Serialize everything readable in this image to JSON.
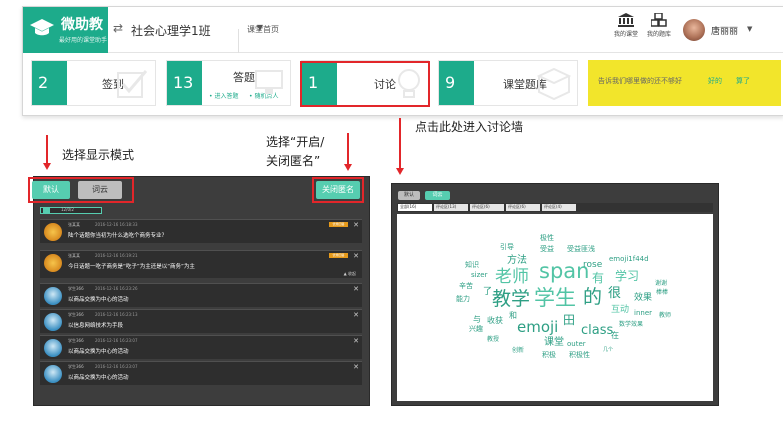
{
  "app": {
    "logo_title": "微助教",
    "logo_sub": "最好用的课堂助手",
    "class_name": "社会心理学1班",
    "breadcrumb": "课堂首页",
    "icons": [
      {
        "icon": "bank-icon",
        "label": "我的课堂"
      },
      {
        "icon": "cubes-icon",
        "label": "我的题库"
      }
    ],
    "user_name": "唐丽丽",
    "brand_color": "#1dab8b"
  },
  "cards": [
    {
      "num": "2",
      "label": "签到",
      "icon": "checkbox-icon"
    },
    {
      "num": "13",
      "label": "答题",
      "sub1": "• 进入答题",
      "sub2": "• 随机点人",
      "icon": "monitor-icon"
    },
    {
      "num": "1",
      "label": "讨论",
      "icon": "bulb-icon"
    },
    {
      "num": "9",
      "label": "课堂题库",
      "icon": "box-icon"
    }
  ],
  "feedback": {
    "question": "告诉我们哪里做的还不够好",
    "link1": "好的",
    "link2": "算了"
  },
  "annotations": {
    "enter": "点击此处进入讨论墙",
    "mode": "选择显示模式",
    "anon_line1": "选择“开启/",
    "anon_line2": "关闭匿名”"
  },
  "left": {
    "mode_default": "默认",
    "mode_cloud": "词云",
    "anon_button": "关闭匿名",
    "filter_label": "12/0/2",
    "collapse": "▲ 收起",
    "messages": [
      {
        "name": "张某某",
        "time": "2016-12-16 16:18:33",
        "text": "陆个话题你当初为什么选吃个商务专业？",
        "tag": "优秀回答",
        "av": "lion"
      },
      {
        "name": "张某某",
        "time": "2016-12-16 16:19:21",
        "text": "今日话题一吃子商务是“吃子”为主还是以“商务”为主",
        "tag": "优秀回答",
        "av": "lion"
      },
      {
        "name": "学生366",
        "time": "2016-12-16 16:23:26",
        "text": "以商品交换为中心的活动",
        "av": "student"
      },
      {
        "name": "学生366",
        "time": "2016-12-16 16:23:13",
        "text": "以信息网络技术为手段",
        "av": "student"
      },
      {
        "name": "学生366",
        "time": "2016-12-16 16:23:07",
        "text": "以商品交换为中心的活动",
        "av": "student"
      },
      {
        "name": "学生366",
        "time": "2016-12-16 16:23:07",
        "text": "以商品交换为中心的活动",
        "av": "student"
      }
    ]
  },
  "right": {
    "mode_default": "默认",
    "mode_cloud": "词云",
    "tabs": [
      "全部(16)",
      "评论区(13)",
      "评论区(6)",
      "评论区(6)",
      "评论区(4)"
    ],
    "words": [
      {
        "t": "span",
        "c": "#52c4a5",
        "s": 21
      },
      {
        "t": "学生",
        "c": "#52c4a5",
        "s": 21
      },
      {
        "t": "教学",
        "c": "#2e9f84",
        "s": 19
      },
      {
        "t": "的",
        "c": "#2e9f84",
        "s": 19
      },
      {
        "t": "老师",
        "c": "#52c4a5",
        "s": 17
      },
      {
        "t": "emoji",
        "c": "#2e9f84",
        "s": 15
      },
      {
        "t": "class",
        "c": "#2e9f84",
        "s": 13
      },
      {
        "t": "学习",
        "c": "#52c4a5",
        "s": 12
      },
      {
        "t": "很",
        "c": "#2e9f84",
        "s": 13
      },
      {
        "t": "有",
        "c": "#52c4a5",
        "s": 12
      },
      {
        "t": "方法",
        "c": "#2e9f84",
        "s": 10
      },
      {
        "t": "rose",
        "c": "#2e9f84",
        "s": 9
      },
      {
        "t": "田",
        "c": "#2e9f84",
        "s": 12
      },
      {
        "t": "课堂",
        "c": "#2e9f84",
        "s": 10
      },
      {
        "t": "效果",
        "c": "#2e9f84",
        "s": 9
      },
      {
        "t": "互动",
        "c": "#52c4a5",
        "s": 9
      },
      {
        "t": "emoji1f44d",
        "c": "#2e9f84",
        "s": 7
      },
      {
        "t": "收获",
        "c": "#2e9f84",
        "s": 8
      },
      {
        "t": "积极",
        "c": "#2e9f84",
        "s": 7
      },
      {
        "t": "积极性",
        "c": "#2e9f84",
        "s": 7
      },
      {
        "t": "outer",
        "c": "#2e9f84",
        "s": 7
      },
      {
        "t": "inner",
        "c": "#2e9f84",
        "s": 7
      },
      {
        "t": "教师",
        "c": "#2e9f84",
        "s": 6
      },
      {
        "t": "谢谢",
        "c": "#2e9f84",
        "s": 6
      },
      {
        "t": "棒棒",
        "c": "#2e9f84",
        "s": 6
      },
      {
        "t": "数学效果",
        "c": "#2e9f84",
        "s": 6
      },
      {
        "t": "引导",
        "c": "#2e9f84",
        "s": 7
      },
      {
        "t": "知识",
        "c": "#2e9f84",
        "s": 7
      },
      {
        "t": "sizer",
        "c": "#2e9f84",
        "s": 7
      },
      {
        "t": "辛苦",
        "c": "#2e9f84",
        "s": 7
      },
      {
        "t": "能力",
        "c": "#2e9f84",
        "s": 7
      },
      {
        "t": "兴趣",
        "c": "#2e9f84",
        "s": 7
      },
      {
        "t": "教授",
        "c": "#2e9f84",
        "s": 6
      },
      {
        "t": "创新",
        "c": "#2e9f84",
        "s": 6
      },
      {
        "t": "受益",
        "c": "#2e9f84",
        "s": 7
      },
      {
        "t": "受益匪浅",
        "c": "#2e9f84",
        "s": 7
      },
      {
        "t": "极性",
        "c": "#2e9f84",
        "s": 7
      },
      {
        "t": "了",
        "c": "#2e9f84",
        "s": 9
      },
      {
        "t": "与",
        "c": "#2e9f84",
        "s": 8
      },
      {
        "t": "和",
        "c": "#2e9f84",
        "s": 8
      },
      {
        "t": "在",
        "c": "#2e9f84",
        "s": 8
      },
      {
        "t": "几个",
        "c": "#2e9f84",
        "s": 5
      }
    ]
  }
}
